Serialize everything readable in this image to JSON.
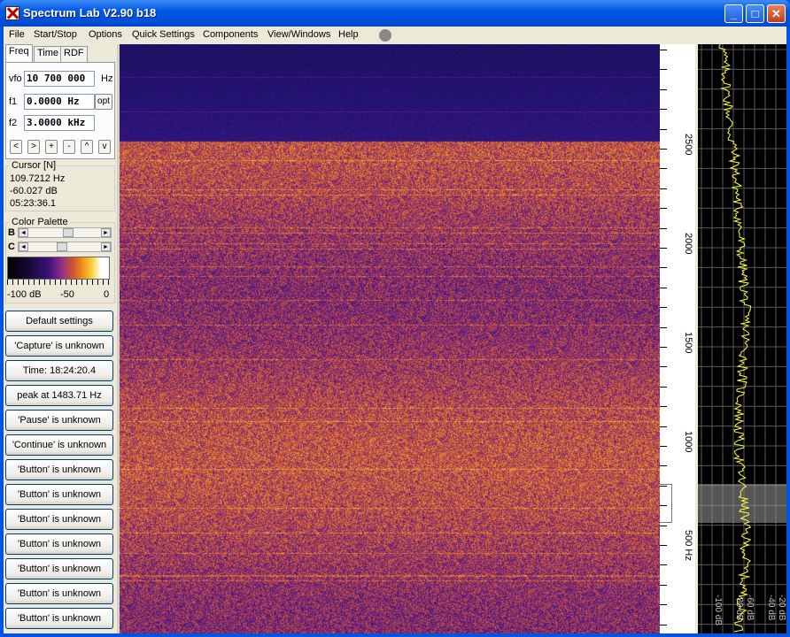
{
  "window": {
    "title": "Spectrum Lab V2.90 b18"
  },
  "titlebar": {
    "minimize": "_",
    "maximize": "□",
    "close": "✕"
  },
  "menu": [
    "File",
    "Start/Stop",
    "Options",
    "Quick Settings",
    "Components",
    "View/Windows",
    "Help"
  ],
  "tabs": [
    "Freq",
    "Time",
    "RDF"
  ],
  "freq": {
    "vfo_label": "vfo",
    "vfo_value": "10 700 000",
    "vfo_unit": "Hz",
    "f1_label": "f1",
    "f1_value": "0.0000 Hz",
    "opt_label": "opt",
    "f2_label": "f2",
    "f2_value": "3.0000 kHz",
    "nav_buttons": [
      "<",
      ">",
      "+",
      "-",
      "^",
      "v"
    ]
  },
  "cursor": {
    "title": "Cursor [N]",
    "freq": "109.7212 Hz",
    "level": "-60.027 dB",
    "time": "05:23:36.1"
  },
  "palette": {
    "title": "Color Palette",
    "b_label": "B",
    "c_label": "C",
    "scale": [
      "-100 dB",
      "-50",
      "0"
    ],
    "b_level": 0.55,
    "c_level": 0.45
  },
  "buttons": [
    "Default settings",
    "'Capture' is unknown",
    "Time:  18:24:20.4",
    "peak at 1483.71 Hz",
    "'Pause' is unknown",
    "'Continue' is unknown",
    "'Button' is unknown",
    "'Button' is unknown",
    "'Button' is unknown",
    "'Button' is unknown",
    "'Button' is unknown",
    "'Button' is unknown",
    "'Button' is unknown"
  ],
  "freq_scale": {
    "labels": [
      "2500",
      "2000",
      "1500",
      "1000",
      "500 Hz"
    ]
  },
  "spectrum_scale": {
    "labels": [
      "-100 dB",
      "-80 dB",
      "-60 dB",
      "-40 dB",
      "-20 dB"
    ]
  },
  "colors": {
    "xp_blue": "#0054e3",
    "trace": "#ffff40",
    "grid": "#5a5a5a"
  }
}
